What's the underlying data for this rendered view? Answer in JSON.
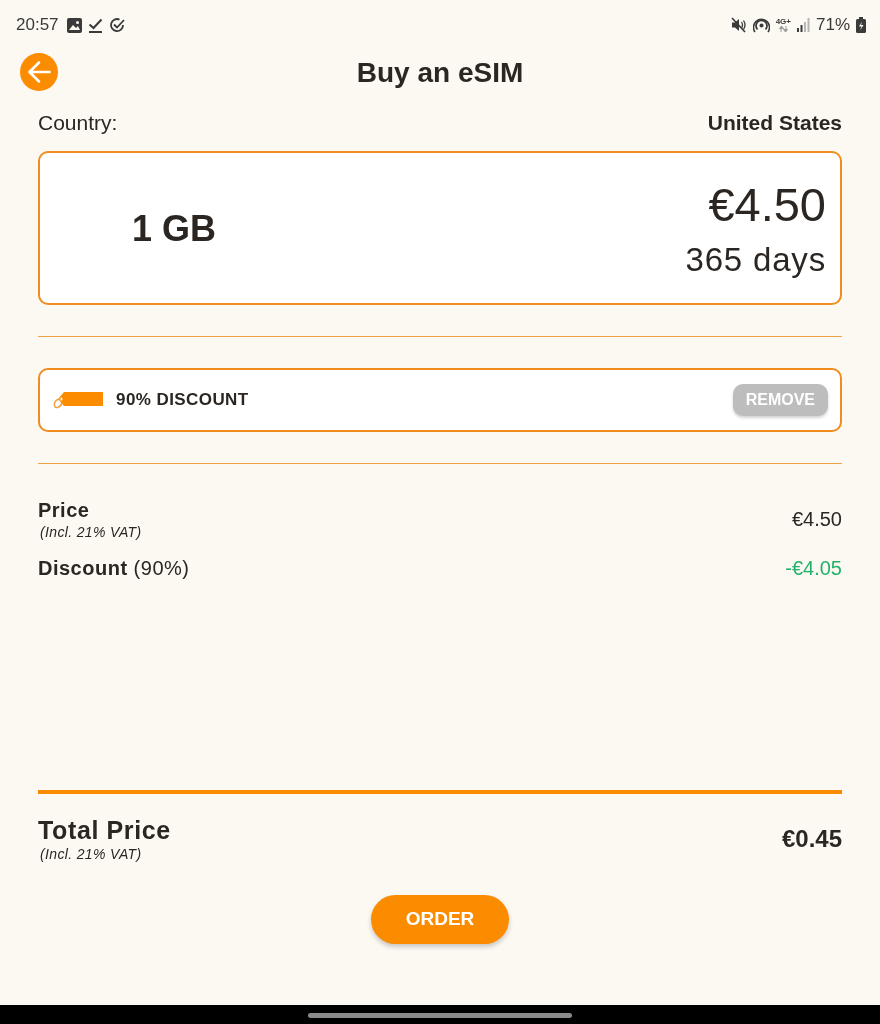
{
  "status_bar": {
    "time": "20:57",
    "network_type": "4G+",
    "battery": "71%"
  },
  "header": {
    "title": "Buy an eSIM"
  },
  "country": {
    "label": "Country:",
    "value": "United States"
  },
  "plan": {
    "data": "1 GB",
    "price": "€4.50",
    "validity": "365 days"
  },
  "coupon": {
    "label": "90% DISCOUNT",
    "action": "REMOVE"
  },
  "summary": [
    {
      "kind": "charge",
      "label": "Price",
      "note": "(Incl. 21% VAT)",
      "amount": "€4.50"
    },
    {
      "kind": "discount",
      "label": "**Discount** (90%)",
      "amount": "-€4.05"
    }
  ],
  "total": {
    "label": "Total Price",
    "note": "(Incl. 21% VAT)",
    "amount": "€0.45"
  },
  "order_button": "ORDER"
}
